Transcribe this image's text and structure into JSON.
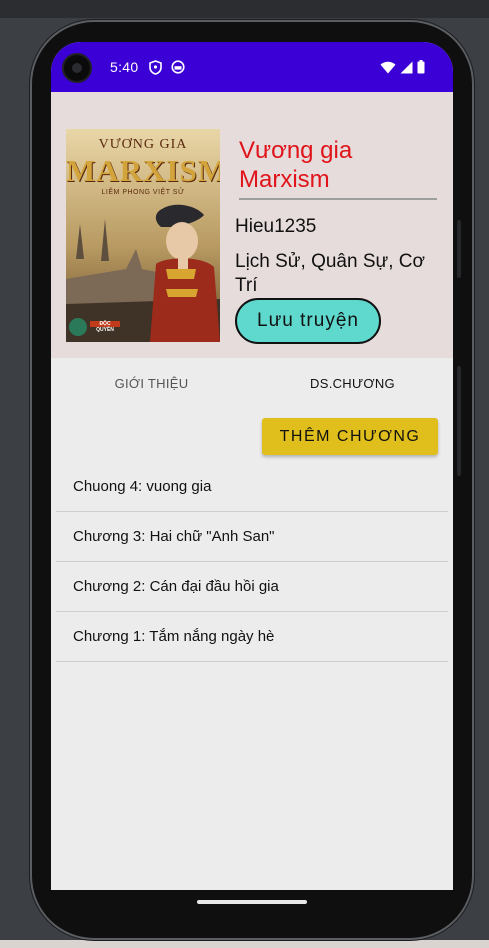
{
  "status_bar": {
    "time": "5:40",
    "icons": [
      "shield-icon",
      "circle-icon",
      "wifi-icon",
      "signal-icon",
      "battery-icon"
    ],
    "color": "#3a00d6"
  },
  "book": {
    "cover_title_line1": "VƯƠNG GIA",
    "cover_title_line2": "MARXISM",
    "cover_subtitle": "LIÊM PHONG VIỆT SỬ",
    "cover_badge": "ĐỘC QUYỀN",
    "title": "Vương gia Marxism",
    "author": "Hieu1235",
    "genres": "Lịch Sử, Quân Sự, Cơ Trí",
    "title_color": "#e0141a"
  },
  "actions": {
    "save_label": "Lưu truyện",
    "add_chapter_label": "THÊM CHƯƠNG"
  },
  "tabs": [
    {
      "label": "GIỚI THIỆU",
      "selected": false
    },
    {
      "label": "DS.CHƯƠNG",
      "selected": true
    }
  ],
  "chapters": [
    {
      "label": "Chuong 4: vuong gia"
    },
    {
      "label": "Chương 3: Hai chữ \"Anh San\""
    },
    {
      "label": "Chương 2: Cán đại đầu hồi gia"
    },
    {
      "label": "Chương 1: Tắm nắng ngày hè"
    }
  ],
  "colors": {
    "header_bg": "#e6dcdb",
    "save_button": "#5fd8ce",
    "add_button": "#e0bf1c"
  }
}
